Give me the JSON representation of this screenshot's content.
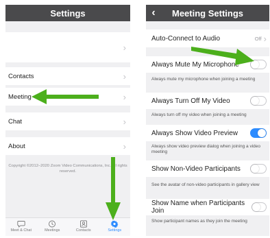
{
  "left": {
    "title": "Settings",
    "items": [
      {
        "label": ""
      },
      {
        "label": "Contacts"
      },
      {
        "label": "Meeting"
      },
      {
        "label": "Chat"
      },
      {
        "label": "About"
      }
    ],
    "chevron": "›",
    "copyright": "Copyright ©2012–2020 Zoom Video Communications, Inc. All rights reserved.",
    "tabs": [
      {
        "label": "Meet & Chat",
        "icon": "chat-bubble-icon"
      },
      {
        "label": "Meetings",
        "icon": "clock-icon"
      },
      {
        "label": "Contacts",
        "icon": "contacts-icon"
      },
      {
        "label": "Settings",
        "icon": "gear-icon"
      }
    ],
    "active_tab": "Settings"
  },
  "right": {
    "title": "Meeting Settings",
    "back": "‹",
    "auto_connect": {
      "label": "Auto-Connect to Audio",
      "value": "Off"
    },
    "settings": [
      {
        "label": "Always Mute My Microphone",
        "description": "Always mute my microphone when joining a meeting",
        "on": false
      },
      {
        "label": "Always Turn Off My Video",
        "description": "Always turn off my video when joining a meeting",
        "on": false
      },
      {
        "label": "Always Show Video Preview",
        "description": "Always show video preview dialog when joining a video meeting",
        "on": true
      },
      {
        "label": "Show Non-Video Participants",
        "description": "See the avatar of non-video participants in gallery view",
        "on": false
      },
      {
        "label": "Show Name when Participants Join",
        "description": "Show participant names as they join the meeting",
        "on": false
      }
    ]
  },
  "colors": {
    "header": "#4a4a4c",
    "accent": "#2d8cff",
    "arrow": "#4caf1c",
    "background": "#f0f0f2"
  }
}
